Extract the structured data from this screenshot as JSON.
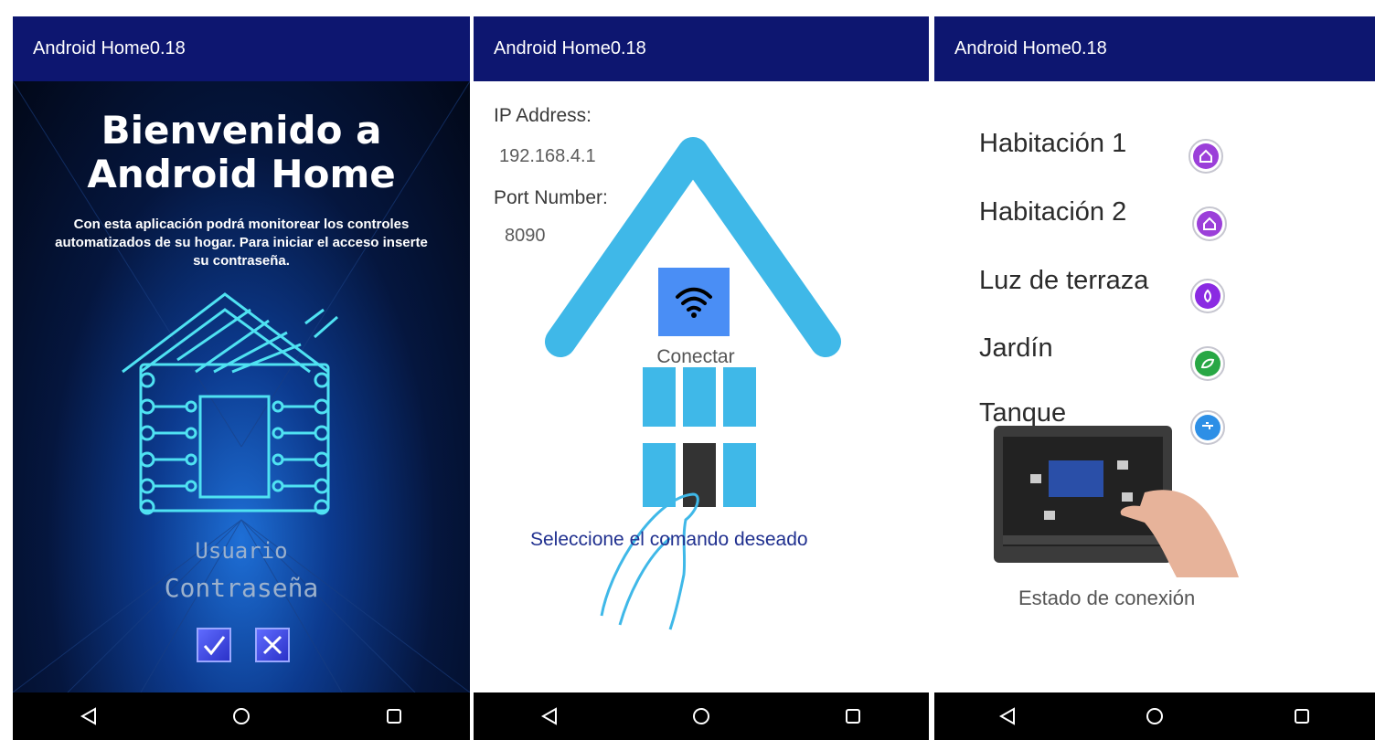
{
  "app_title": "Android Home0.18",
  "login": {
    "title_line1": "Bienvenido a",
    "title_line2": "Android Home",
    "description": "Con esta aplicación podrá monitorear  los controles automatizados de su hogar. Para iniciar el acceso inserte su contraseña.",
    "user_placeholder": "Usuario",
    "password_placeholder": "Contraseña"
  },
  "connection": {
    "ip_label": "IP Address:",
    "ip_value": "192.168.4.1",
    "port_label": "Port Number:",
    "port_value": "8090",
    "connect_label": "Conectar",
    "instruction": "Seleccione el comando deseado"
  },
  "rooms": {
    "items": [
      {
        "label": "Habitación 1",
        "icon": "home-icon",
        "color": "#9b3fd9"
      },
      {
        "label": "Habitación 2",
        "icon": "home-icon",
        "color": "#9b3fd9"
      },
      {
        "label": "Luz de terraza",
        "icon": "bulb-icon",
        "color": "#8a2be2"
      },
      {
        "label": "Jardín",
        "icon": "garden-icon",
        "color": "#28a745"
      },
      {
        "label": "Tanque",
        "icon": "faucet-icon",
        "color": "#2d8fe6"
      }
    ],
    "status_label": "Estado de conexión"
  },
  "colors": {
    "appbar": "#0d1670",
    "house": "#3fb8e8",
    "wifi_button": "#4a8ef5",
    "nav": "#000000"
  }
}
